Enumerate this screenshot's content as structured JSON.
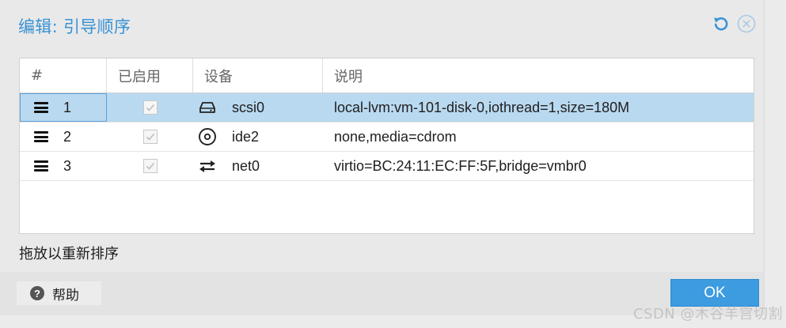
{
  "dialog": {
    "title": "编辑: 引导顺序",
    "reset_icon": "reset-icon",
    "close_icon": "close-circle-icon"
  },
  "grid": {
    "columns": [
      "#",
      "已启用",
      "设备",
      "说明"
    ],
    "rows": [
      {
        "order": "1",
        "enabled": true,
        "device_icon": "hdd-icon",
        "device": "scsi0",
        "desc": "local-lvm:vm-101-disk-0,iothread=1,size=180M",
        "selected": true
      },
      {
        "order": "2",
        "enabled": true,
        "device_icon": "cdrom-icon",
        "device": "ide2",
        "desc": "none,media=cdrom",
        "selected": false
      },
      {
        "order": "3",
        "enabled": true,
        "device_icon": "network-icon",
        "device": "net0",
        "desc": "virtio=BC:24:11:EC:FF:5F,bridge=vmbr0",
        "selected": false
      }
    ]
  },
  "hint": "拖放以重新排序",
  "footer": {
    "help_label": "帮助",
    "ok_label": "OK"
  },
  "watermark": "CSDN @木谷羊宫切割",
  "colors": {
    "title": "#3892d4",
    "selected_row": "#b9d9f0",
    "ok_button": "#3d9be0"
  }
}
